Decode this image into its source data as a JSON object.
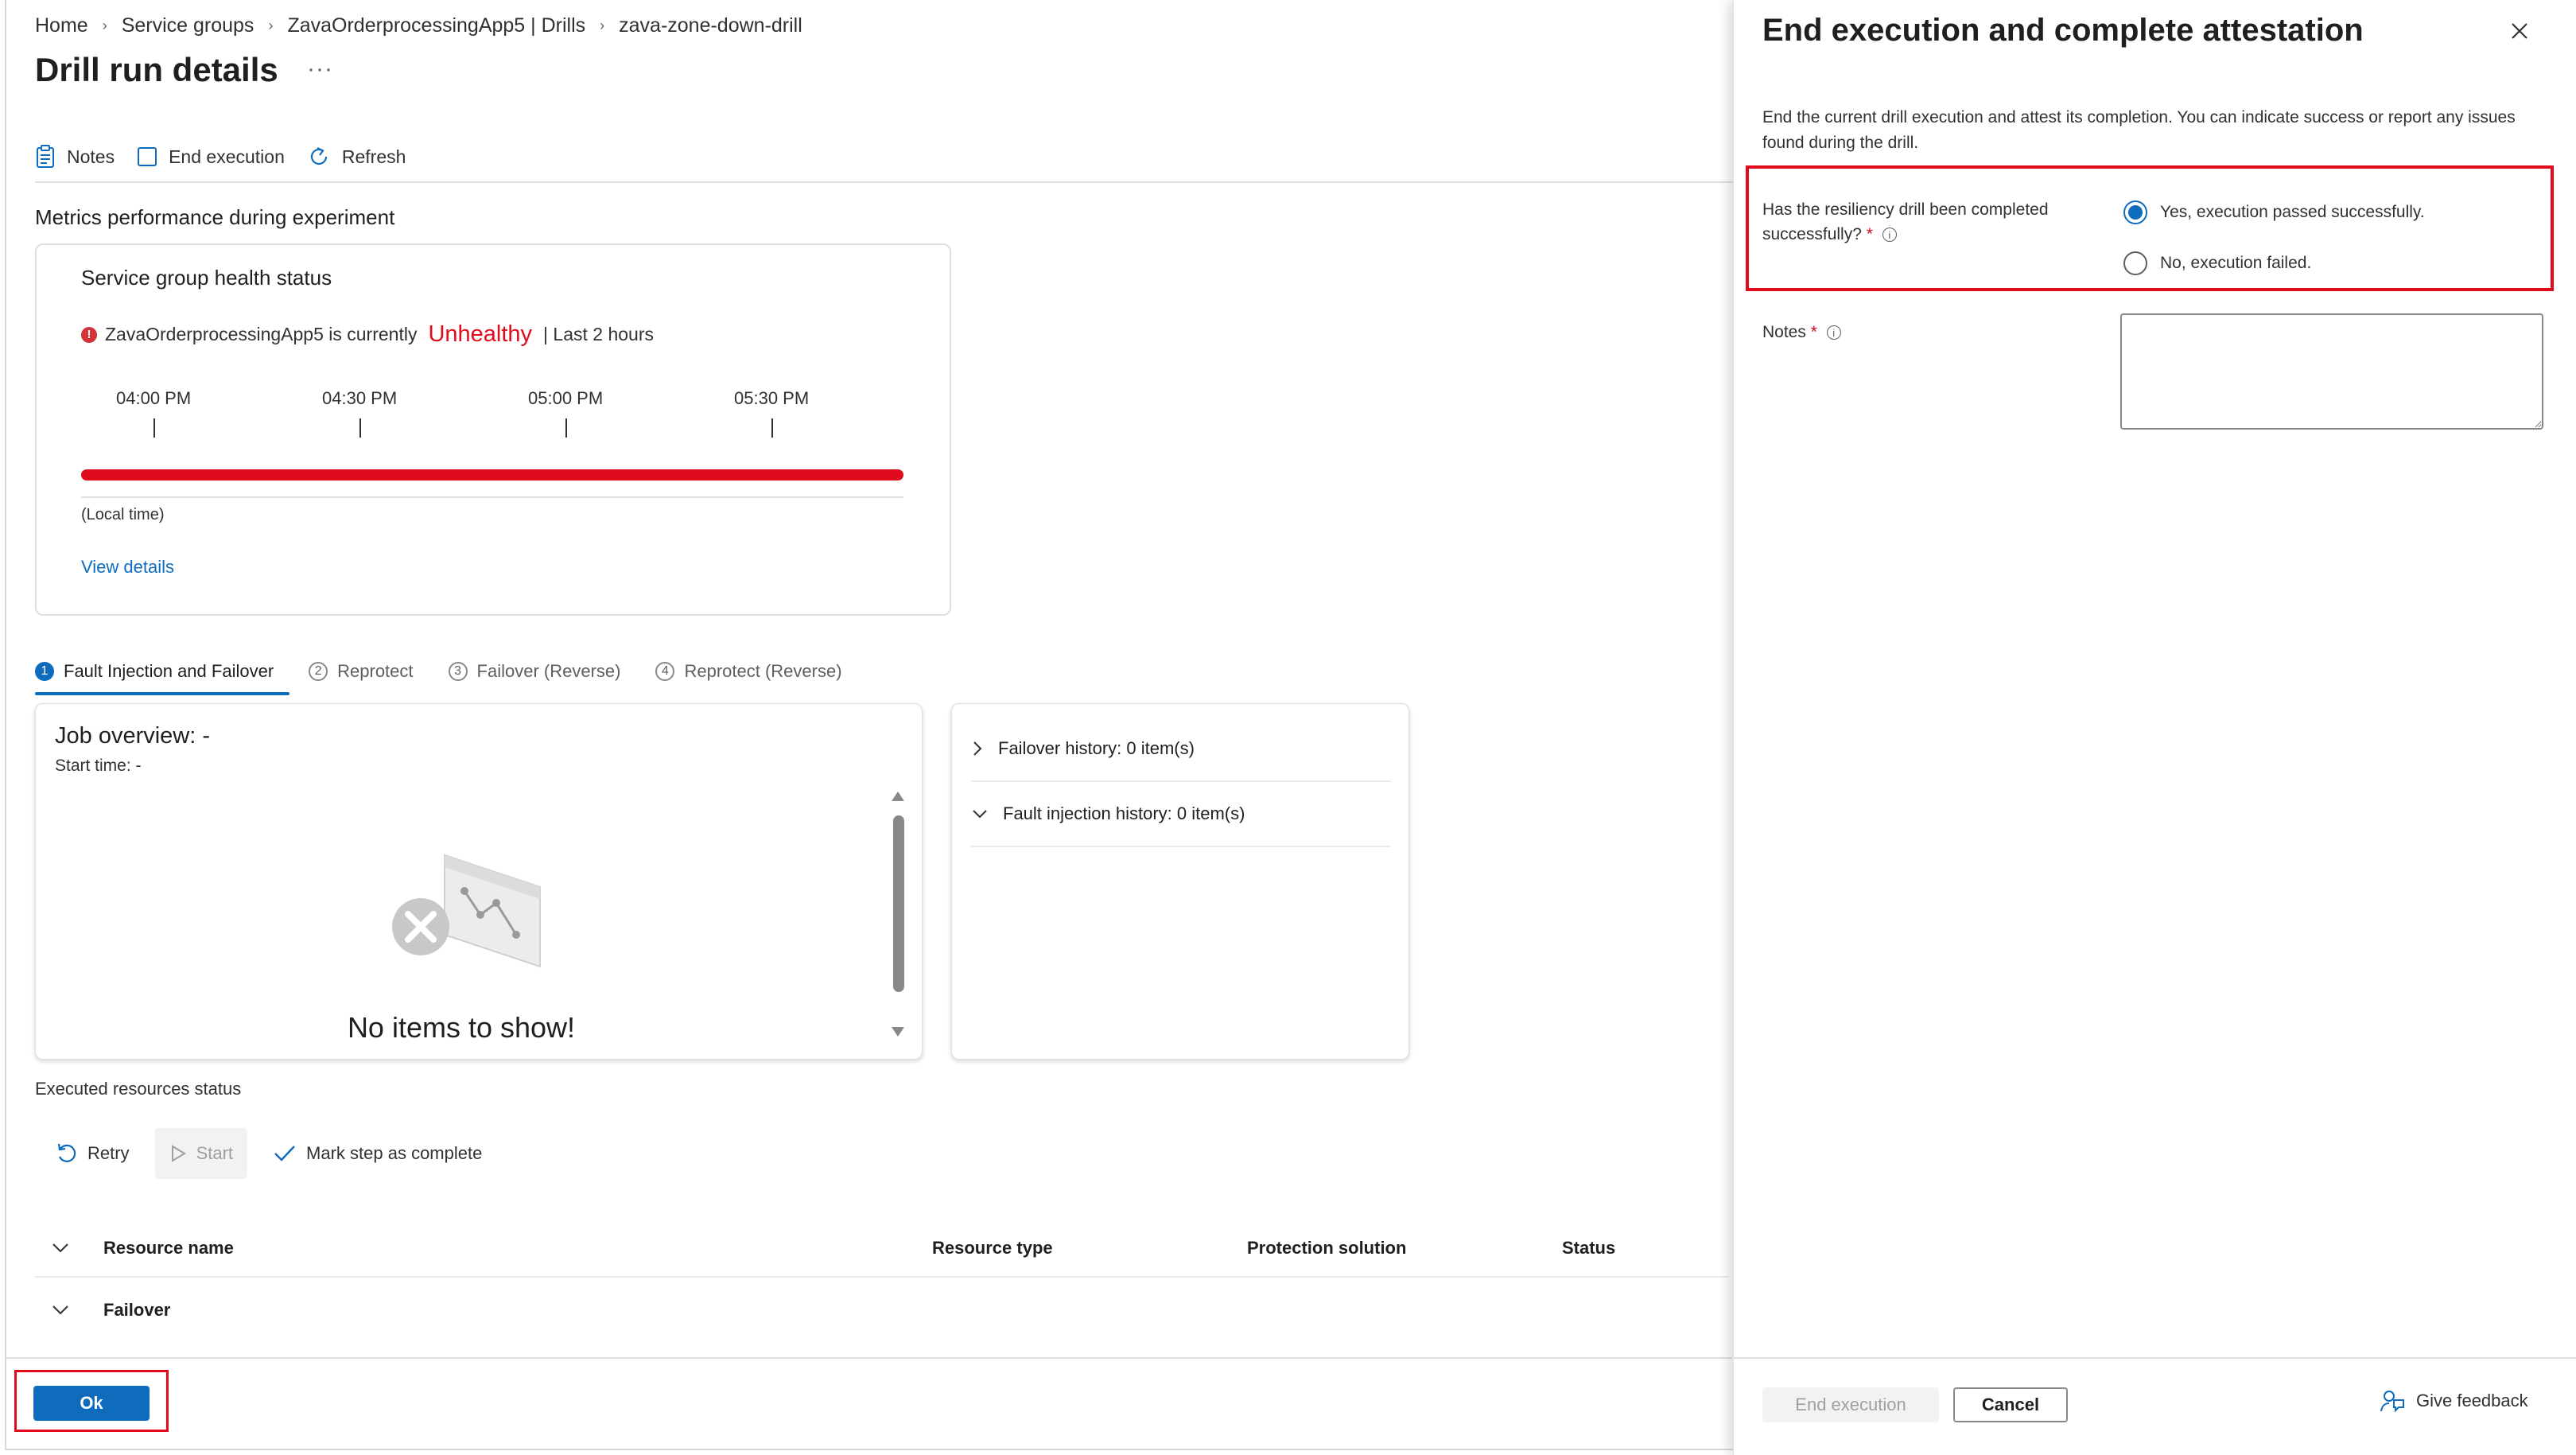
{
  "breadcrumb": [
    "Home",
    "Service groups",
    "ZavaOrderprocessingApp5 | Drills",
    "zava-zone-down-drill"
  ],
  "page": {
    "title": "Drill run details",
    "more": "···"
  },
  "toolbar": {
    "notes": "Notes",
    "end_execution": "End execution",
    "refresh": "Refresh"
  },
  "metrics": {
    "section_title": "Metrics performance during experiment",
    "card_title": "Service group health status",
    "status_prefix": "ZavaOrderprocessingApp5 is currently",
    "status_value": "Unhealthy",
    "status_suffix": "| Last 2 hours",
    "ticks": [
      "04:00 PM",
      "04:30 PM",
      "05:00 PM",
      "05:30 PM"
    ],
    "local_time": "(Local time)",
    "view_details": "View details",
    "status_color": "#e00b1c"
  },
  "steps": [
    {
      "num": "1",
      "label": "Fault Injection and Failover",
      "active": true
    },
    {
      "num": "2",
      "label": "Reprotect"
    },
    {
      "num": "3",
      "label": "Failover (Reverse)"
    },
    {
      "num": "4",
      "label": "Reprotect (Reverse)"
    }
  ],
  "job": {
    "title": "Job overview: -",
    "start_time": "Start time: -",
    "empty": "No items to show!"
  },
  "history": {
    "failover": "Failover history: 0 item(s)",
    "fault_injection": "Fault injection history: 0 item(s)"
  },
  "executed": {
    "label": "Executed resources status",
    "retry": "Retry",
    "start": "Start",
    "mark_complete": "Mark step as complete",
    "columns": {
      "name": "Resource name",
      "type": "Resource type",
      "protection": "Protection solution",
      "status": "Status"
    },
    "group_row": "Failover"
  },
  "footer": {
    "ok": "Ok"
  },
  "panel": {
    "title": "End execution and complete attestation",
    "description": "End the current drill execution and attest its completion. You can indicate success or report any issues found during the drill.",
    "question": "Has the resiliency drill been completed successfully?",
    "required": "*",
    "options": [
      {
        "label": "Yes, execution passed successfully.",
        "selected": true
      },
      {
        "label": "No, execution failed.",
        "selected": false
      }
    ],
    "notes_label": "Notes",
    "notes_value": "",
    "end_button": "End execution",
    "cancel_button": "Cancel",
    "feedback": "Give feedback"
  },
  "colors": {
    "accent": "#0f6cbd",
    "error": "#e00b1c"
  }
}
